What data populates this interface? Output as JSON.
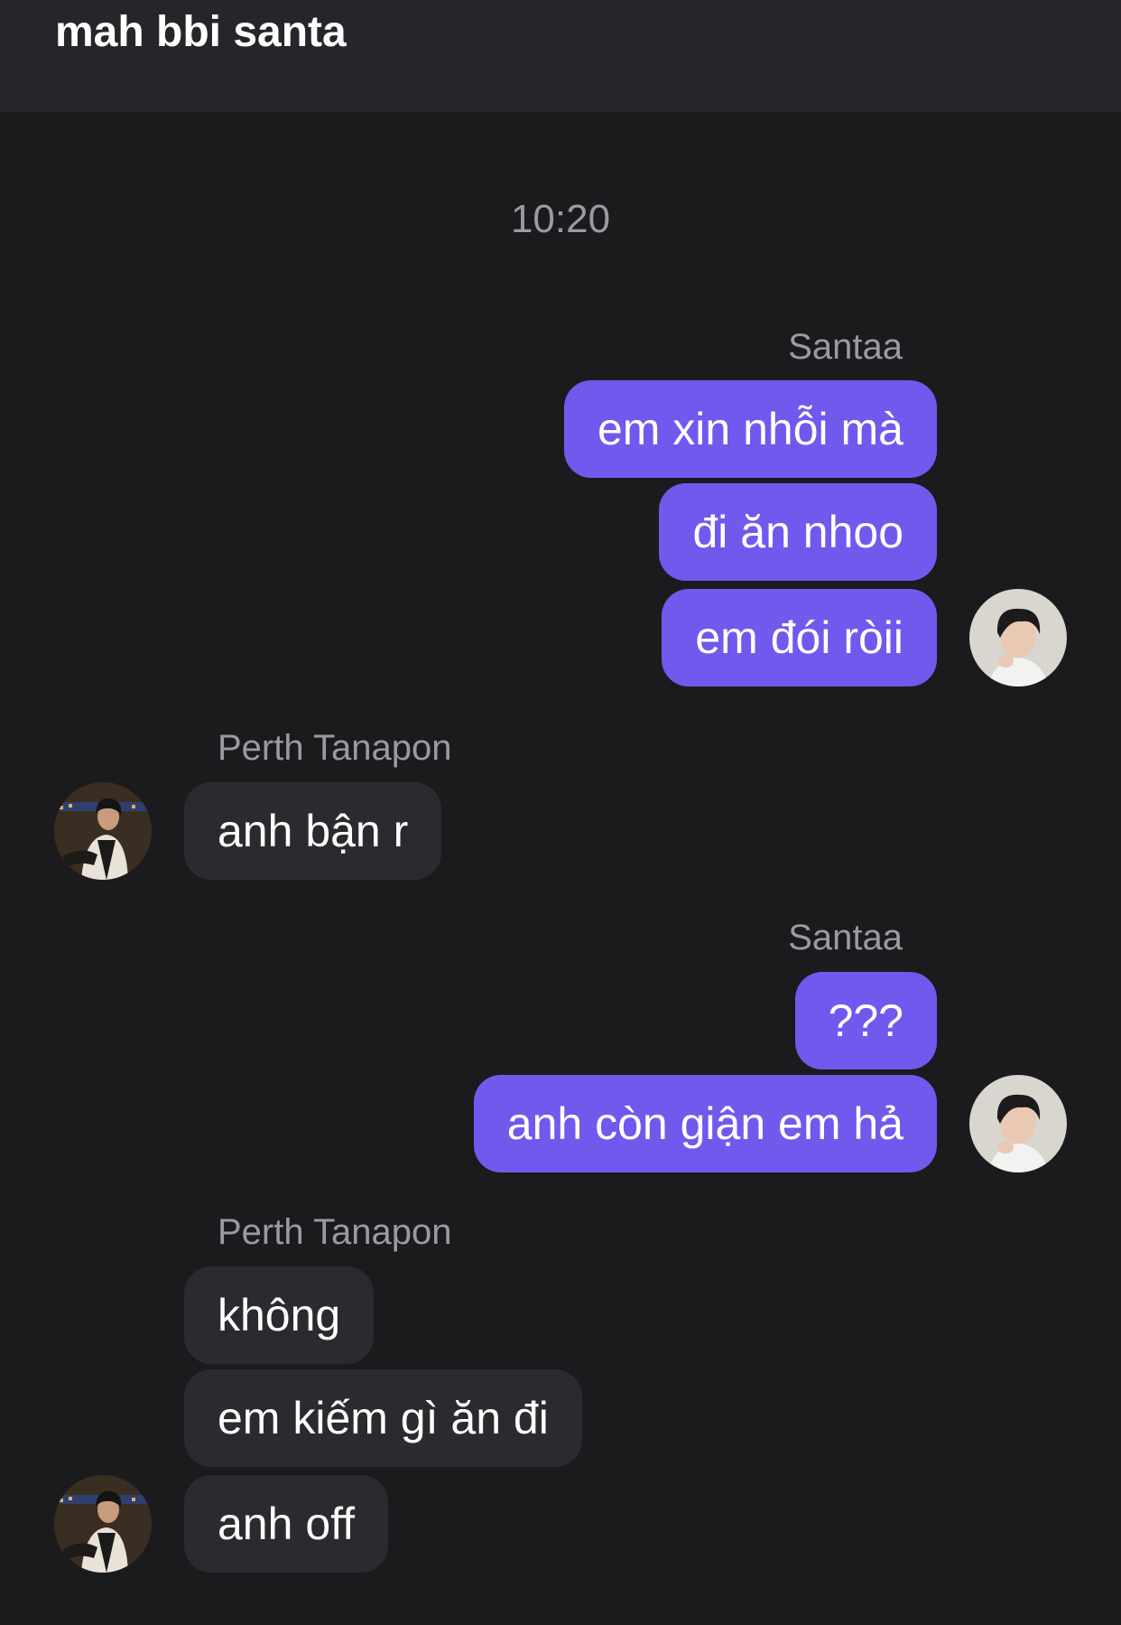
{
  "header": {
    "title": "mah bbi santa"
  },
  "conversation": {
    "timestamp": "10:20",
    "groups": [
      {
        "sender": "Santaa",
        "direction": "outgoing",
        "messages": [
          "em xin nhỗi mà",
          "đi ăn nhoo",
          "em đói ròii"
        ]
      },
      {
        "sender": "Perth Tanapon",
        "direction": "incoming",
        "messages": [
          "anh bận r"
        ]
      },
      {
        "sender": "Santaa",
        "direction": "outgoing",
        "messages": [
          "???",
          "anh còn giận em hả"
        ]
      },
      {
        "sender": "Perth Tanapon",
        "direction": "incoming",
        "messages": [
          "không",
          "em kiếm gì ăn đi",
          "anh off"
        ]
      }
    ]
  },
  "colors": {
    "background": "#1b1b1e",
    "header_background": "#25252a",
    "outgoing_bubble": "#7159ee",
    "incoming_bubble": "#2b2b2f",
    "meta_text": "#9a9aa0"
  },
  "icons": {
    "outgoing_avatar": "avatar-santaa",
    "incoming_avatar": "avatar-perth-tanapon"
  }
}
